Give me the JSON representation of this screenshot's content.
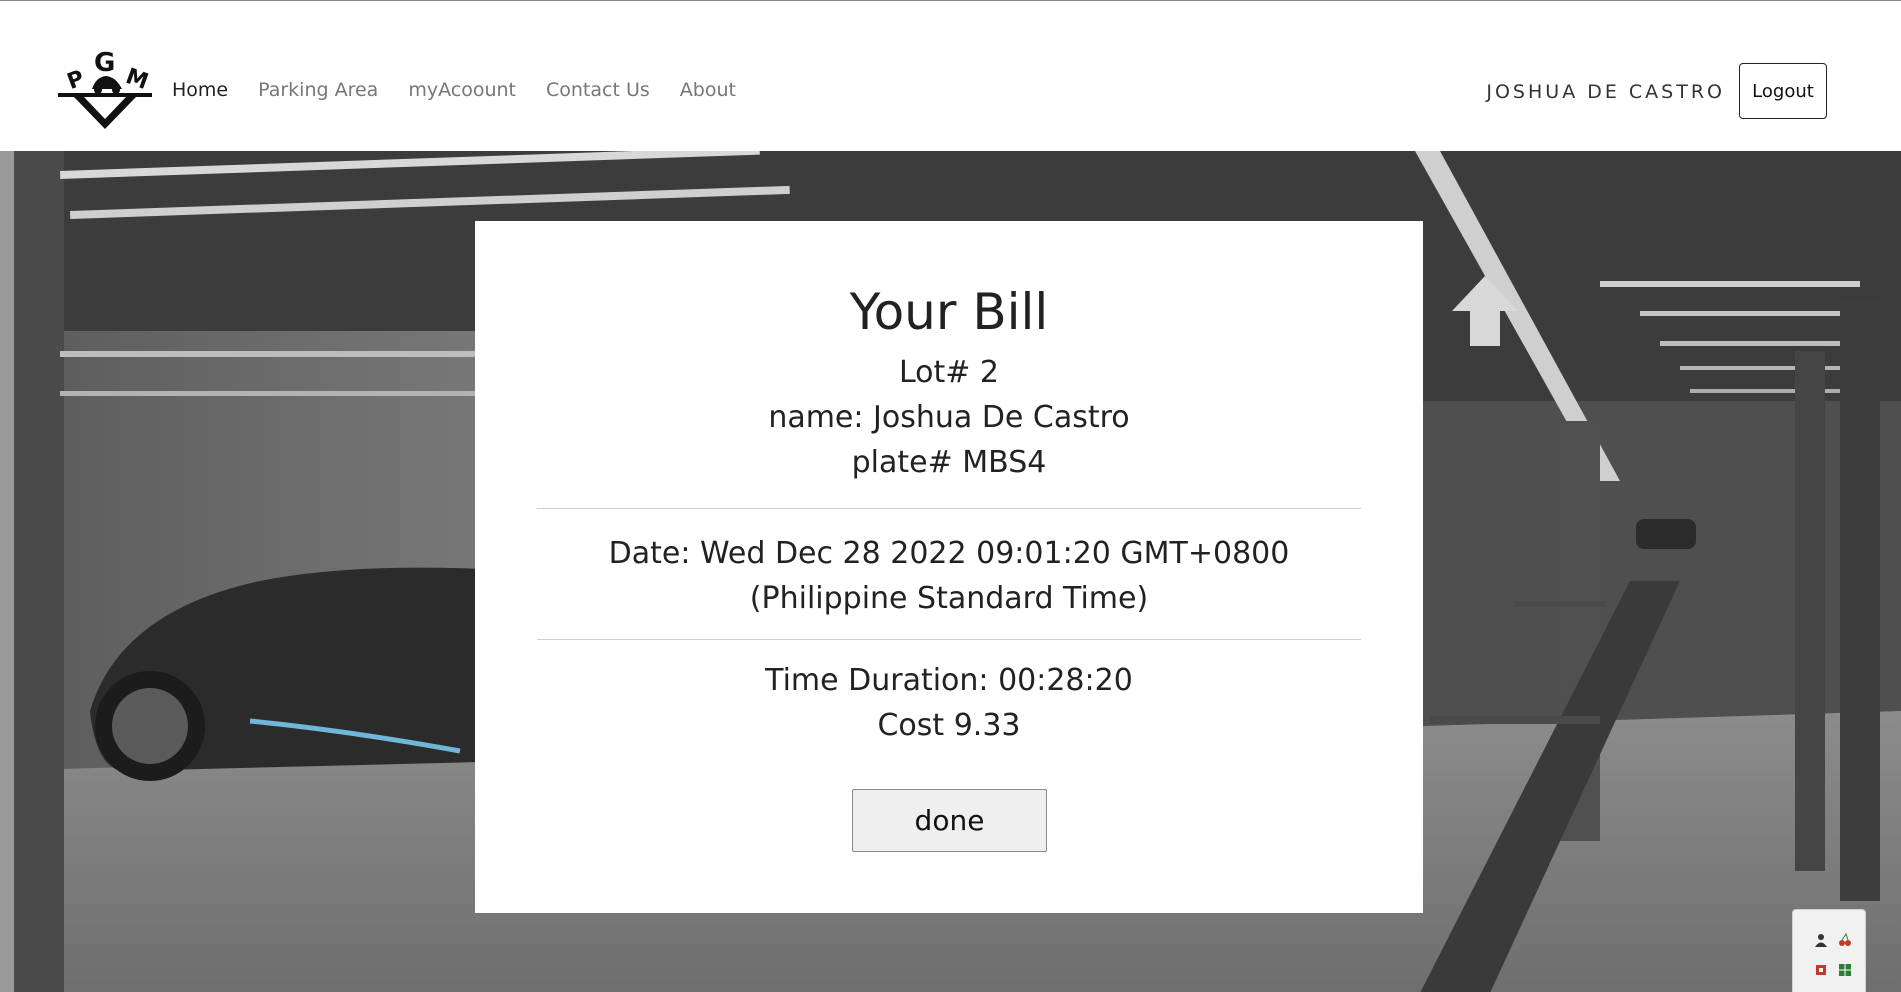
{
  "brand": {
    "logo_text": "PGM"
  },
  "nav": {
    "items": [
      {
        "label": "Home",
        "active": true
      },
      {
        "label": "Parking Area",
        "active": false
      },
      {
        "label": "myAcoount",
        "active": false
      },
      {
        "label": "Contact Us",
        "active": false
      },
      {
        "label": "About",
        "active": false
      }
    ]
  },
  "user": {
    "name": "JOSHUA DE CASTRO",
    "logout_label": "Logout"
  },
  "bill": {
    "title": "Your Bill",
    "lot": "Lot# 2",
    "name": "name: Joshua De Castro",
    "plate": "plate# MBS4",
    "date": "Date: Wed Dec 28 2022 09:01:20 GMT+0800 (Philippine Standard Time)",
    "duration": "Time Duration: 00:28:20",
    "cost": "Cost 9.33",
    "done_label": "done"
  },
  "tray": {
    "icons": [
      "person-icon",
      "cherry-icon",
      "chip-icon",
      "grid-icon"
    ]
  },
  "colors": {
    "navbar_bg": "#ffffff",
    "modal_bg": "#ffffff",
    "button_bg": "#efefef",
    "text": "#222222",
    "nav_muted": "#777777"
  }
}
